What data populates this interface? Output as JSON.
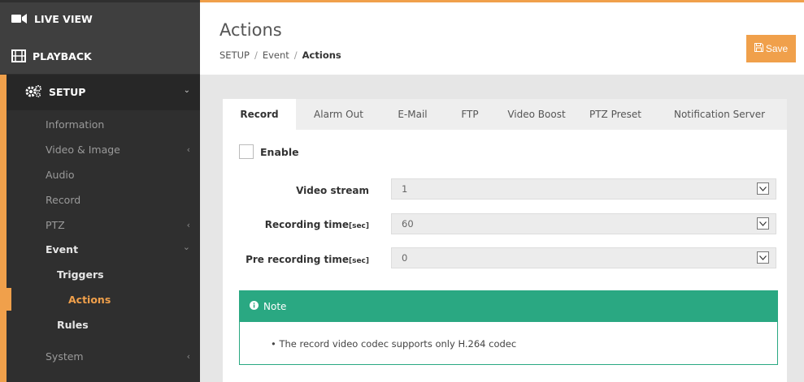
{
  "colors": {
    "accent": "#f0a04b",
    "note_green": "#2aa882",
    "sidebar_bg": "#2f2f2f"
  },
  "sidebar": {
    "live_view": {
      "label": "LIVE VIEW",
      "icon": "video-camera-icon"
    },
    "playback": {
      "label": "PLAYBACK",
      "icon": "film-icon"
    },
    "setup": {
      "label": "SETUP",
      "icon": "gears-icon"
    },
    "items": [
      {
        "label": "Information"
      },
      {
        "label": "Video & Image"
      },
      {
        "label": "Audio"
      },
      {
        "label": "Record"
      },
      {
        "label": "PTZ"
      },
      {
        "label": "Event"
      },
      {
        "label": "Triggers"
      },
      {
        "label": "Actions"
      },
      {
        "label": "Rules"
      },
      {
        "label": "System"
      }
    ]
  },
  "header": {
    "title": "Actions",
    "breadcrumb": [
      "SETUP",
      "Event",
      "Actions"
    ],
    "save_label": "Save"
  },
  "tabs": [
    "Record",
    "Alarm Out",
    "E-Mail",
    "FTP",
    "Video Boost",
    "PTZ Preset",
    "Notification Server"
  ],
  "form": {
    "enable_label": "Enable",
    "enable_checked": false,
    "fields": [
      {
        "label": "Video stream",
        "unit": "",
        "value": "1"
      },
      {
        "label": "Recording time",
        "unit": "[sec]",
        "value": "60"
      },
      {
        "label": "Pre recording time",
        "unit": "[sec]",
        "value": "0"
      }
    ]
  },
  "note": {
    "title": "Note",
    "items": [
      "The record video codec supports only H.264 codec"
    ]
  }
}
